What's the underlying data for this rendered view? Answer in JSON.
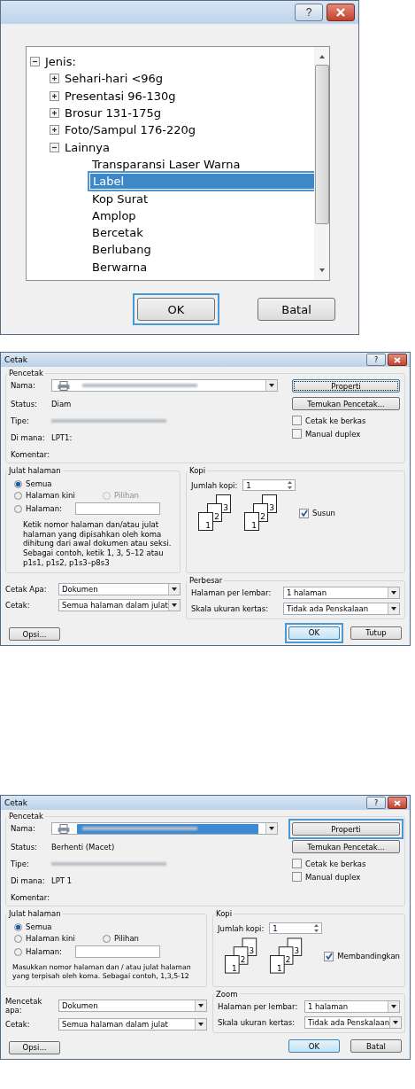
{
  "tree_dialog": {
    "help_button": "?",
    "tree": {
      "label": "Jenis:",
      "expanded": true,
      "selected": false,
      "children": [
        {
          "label": "Sehari-hari <96g",
          "expanded": false,
          "selected": false
        },
        {
          "label": "Presentasi 96-130g",
          "expanded": false,
          "selected": false
        },
        {
          "label": "Brosur 131-175g",
          "expanded": false,
          "selected": false
        },
        {
          "label": "Foto/Sampul 176-220g",
          "expanded": false,
          "selected": false
        },
        {
          "label": "Lainnya",
          "expanded": true,
          "selected": false,
          "children": [
            {
              "label": "Transparansi Laser Warna",
              "selected": false
            },
            {
              "label": "Label",
              "selected": true
            },
            {
              "label": "Kop Surat",
              "selected": false
            },
            {
              "label": "Amplop",
              "selected": false
            },
            {
              "label": "Bercetak",
              "selected": false
            },
            {
              "label": "Berlubang",
              "selected": false
            },
            {
              "label": "Berwarna",
              "selected": false
            }
          ]
        }
      ]
    },
    "buttons": [
      {
        "label": "OK",
        "highlighted": true
      },
      {
        "label": "Batal",
        "highlighted": false
      }
    ]
  },
  "print_dialogs": [
    {
      "title": "Cetak",
      "help_button": "?",
      "printer_group": "Pencetak",
      "name_label": "Nama:",
      "name_selected": false,
      "properties_button": {
        "label": "Properti",
        "highlighted": false,
        "focused": true
      },
      "find_button": "Temukan Pencetak...",
      "info_rows": [
        {
          "label": "Status:",
          "kind": "text",
          "value": "Diam"
        },
        {
          "label": "Tipe:",
          "kind": "blurred"
        },
        {
          "label": "Di mana:",
          "kind": "text",
          "value": "LPT1:"
        },
        {
          "label": "Komentar:",
          "kind": "text"
        }
      ],
      "checks": [
        {
          "label": "Cetak ke berkas",
          "checked": false
        },
        {
          "label": "Manual duplex",
          "checked": false
        }
      ],
      "range": {
        "title": "Julat halaman",
        "options": [
          {
            "label": "Semua",
            "selected": true,
            "disabled": false
          },
          {
            "label": "Halaman kini",
            "selected": false,
            "disabled": false
          },
          {
            "label": "Pilihan",
            "selected": false,
            "disabled": true
          }
        ],
        "pages_label": "Halaman:",
        "pages_selected": false,
        "hint_lines": [
          "Ketik nomor halaman dan/atau julat",
          "halaman yang dipisahkan oleh koma",
          "dihitung dari awal dokumen atau seksi.",
          "Sebagai contoh, ketik 1, 3, 5–12 atau",
          "p1s1, p1s2, p1s3–p8s3"
        ]
      },
      "copies": {
        "title": "Kopi",
        "label": "Jumlah kopi:",
        "value": "1",
        "stacks": [
          [
            "3",
            "2",
            "1"
          ],
          [
            "3",
            "2",
            "1"
          ]
        ],
        "collate": {
          "label": "Susun",
          "checked": true
        }
      },
      "selects": [
        {
          "label": "Cetak Apa:",
          "value": "Dokumen"
        },
        {
          "label": "Cetak:",
          "value": "Semua halaman dalam julat"
        }
      ],
      "zoom": {
        "title": "Perbesar",
        "rows": [
          {
            "label": "Halaman per lembar:",
            "value": "1 halaman"
          },
          {
            "label": "Skala ukuran kertas:",
            "value": "Tidak ada Penskalaan"
          }
        ]
      },
      "buttons": [
        {
          "kind": "options",
          "label": "Opsi...",
          "highlighted": false
        },
        {
          "kind": "ok",
          "label": "OK",
          "highlighted": true
        },
        {
          "kind": "cancel",
          "label": "Tutup",
          "highlighted": false
        }
      ]
    },
    {
      "title": "Cetak",
      "help_button": "?",
      "printer_group": "Pencetak",
      "name_label": "Nama:",
      "name_selected": true,
      "properties_button": {
        "label": "Properti",
        "highlighted": true,
        "focused": false
      },
      "find_button": "Temukan Pencetak...",
      "info_rows": [
        {
          "label": "Status:",
          "kind": "text",
          "value": "Berhenti (Macet)"
        },
        {
          "label": "Tipe:",
          "kind": "blurred"
        },
        {
          "label": "Di mana:",
          "kind": "text",
          "value": "LPT 1"
        },
        {
          "label": "Komentar:",
          "kind": "text"
        }
      ],
      "checks": [
        {
          "label": "Cetak ke berkas",
          "checked": false
        },
        {
          "label": "Manual duplex",
          "checked": false
        }
      ],
      "range": {
        "title": "Julat halaman",
        "options": [
          {
            "label": "Semua",
            "selected": true,
            "disabled": false
          },
          {
            "label": "Halaman kini",
            "selected": false,
            "disabled": false
          },
          {
            "label": "Pilihan",
            "selected": false,
            "disabled": false
          }
        ],
        "pages_label": "Halaman:",
        "pages_selected": false,
        "hint_lines": [
          "Masukkan nomor halaman dan / atau julat halaman",
          "yang terpisah oleh koma. Sebagai contoh, 1,3,5-12"
        ]
      },
      "copies": {
        "title": "Kopi",
        "label": "Jumlah kopi:",
        "value": "1",
        "stacks": [
          [
            "3",
            "2",
            "1"
          ],
          [
            "3",
            "2",
            "1"
          ]
        ],
        "collate": {
          "label": "Membandingkan",
          "checked": true
        }
      },
      "selects": [
        {
          "label": "Mencetak apa:",
          "value": "Dokumen"
        },
        {
          "label": "Cetak:",
          "value": "Semua halaman dalam julat"
        }
      ],
      "zoom": {
        "title": "Zoom",
        "rows": [
          {
            "label": "Halaman per lembar:",
            "value": "1 halaman"
          },
          {
            "label": "Skala ukuran kertas:",
            "value": "Tidak ada Penskalaan"
          }
        ]
      },
      "buttons": [
        {
          "kind": "options",
          "label": "Opsi...",
          "highlighted": false
        },
        {
          "kind": "ok",
          "label": "OK",
          "highlighted": false
        },
        {
          "kind": "cancel",
          "label": "Batal",
          "highlighted": false
        }
      ]
    }
  ]
}
